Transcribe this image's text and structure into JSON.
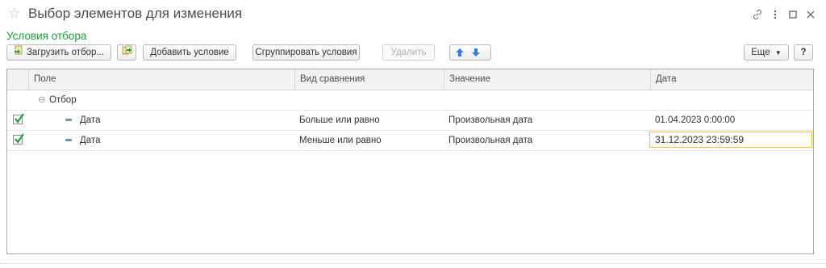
{
  "window": {
    "title": "Выбор элементов для изменения",
    "section_label": "Условия отбора"
  },
  "toolbar": {
    "load_filter": "Загрузить отбор...",
    "add_condition": "Добавить условие",
    "group_conditions": "Сгруппировать условия",
    "delete": "Удалить",
    "more": "Еще",
    "help": "?"
  },
  "table": {
    "columns": [
      "Поле",
      "Вид сравнения",
      "Значение",
      "Дата"
    ],
    "group": {
      "label": "Отбор"
    },
    "rows": [
      {
        "checked": true,
        "field": "Дата",
        "comparison": "Больше или равно",
        "value": "Произвольная дата",
        "date": "01.04.2023 0:00:00"
      },
      {
        "checked": true,
        "field": "Дата",
        "comparison": "Меньше или равно",
        "value": "Произвольная дата",
        "date": "31.12.2023 23:59:59"
      }
    ]
  },
  "colors": {
    "accent_green": "#18a135",
    "focus_border": "#f0c040",
    "arrow_blue": "#3a7bd5"
  }
}
